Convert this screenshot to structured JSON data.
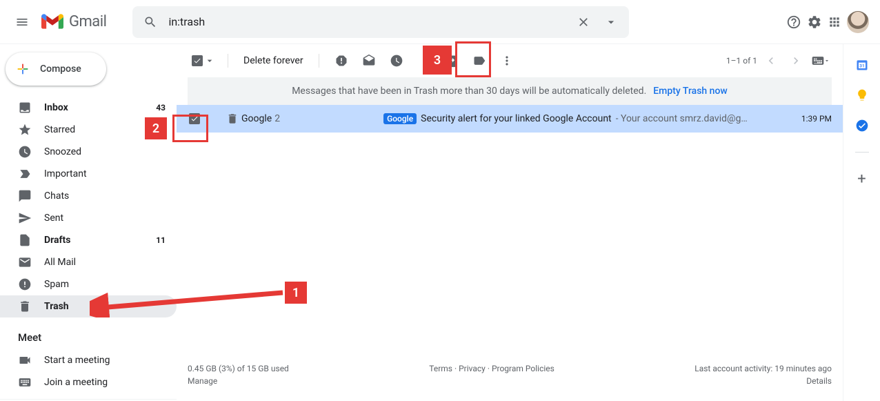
{
  "header": {
    "product": "Gmail",
    "search_value": "in:trash"
  },
  "compose_label": "Compose",
  "sidebar": {
    "items": [
      {
        "label": "Inbox",
        "count": "43",
        "bold": true,
        "icon": "inbox"
      },
      {
        "label": "Starred",
        "icon": "star"
      },
      {
        "label": "Snoozed",
        "icon": "clock"
      },
      {
        "label": "Important",
        "icon": "important"
      },
      {
        "label": "Chats",
        "icon": "chat"
      },
      {
        "label": "Sent",
        "icon": "sent"
      },
      {
        "label": "Drafts",
        "count": "11",
        "bold": true,
        "icon": "file"
      },
      {
        "label": "All Mail",
        "icon": "mail"
      },
      {
        "label": "Spam",
        "icon": "spam"
      },
      {
        "label": "Trash",
        "icon": "trash",
        "active": true,
        "bold": true
      }
    ]
  },
  "meet": {
    "heading": "Meet",
    "items": [
      {
        "label": "Start a meeting",
        "icon": "video"
      },
      {
        "label": "Join a meeting",
        "icon": "keyboard"
      }
    ]
  },
  "toolbar": {
    "delete_forever": "Delete forever",
    "pager": "1–1 of 1"
  },
  "banner": {
    "text": "Messages that have been in Trash more than 30 days will be automatically deleted.",
    "link": "Empty Trash now"
  },
  "messages": [
    {
      "sender": "Google",
      "count": "2",
      "badge": "Google",
      "subject": "Security alert for your linked Google Account",
      "snippet": " - Your account smrz.david@g…",
      "time": "1:39 PM"
    }
  ],
  "footer": {
    "storage": "0.45 GB (3%) of 15 GB used",
    "manage": "Manage",
    "terms": "Terms",
    "privacy": "Privacy",
    "policies": "Program Policies",
    "activity": "Last account activity: 19 minutes ago",
    "details": "Details"
  },
  "annotations": {
    "m1": "1",
    "m2": "2",
    "m3": "3"
  }
}
